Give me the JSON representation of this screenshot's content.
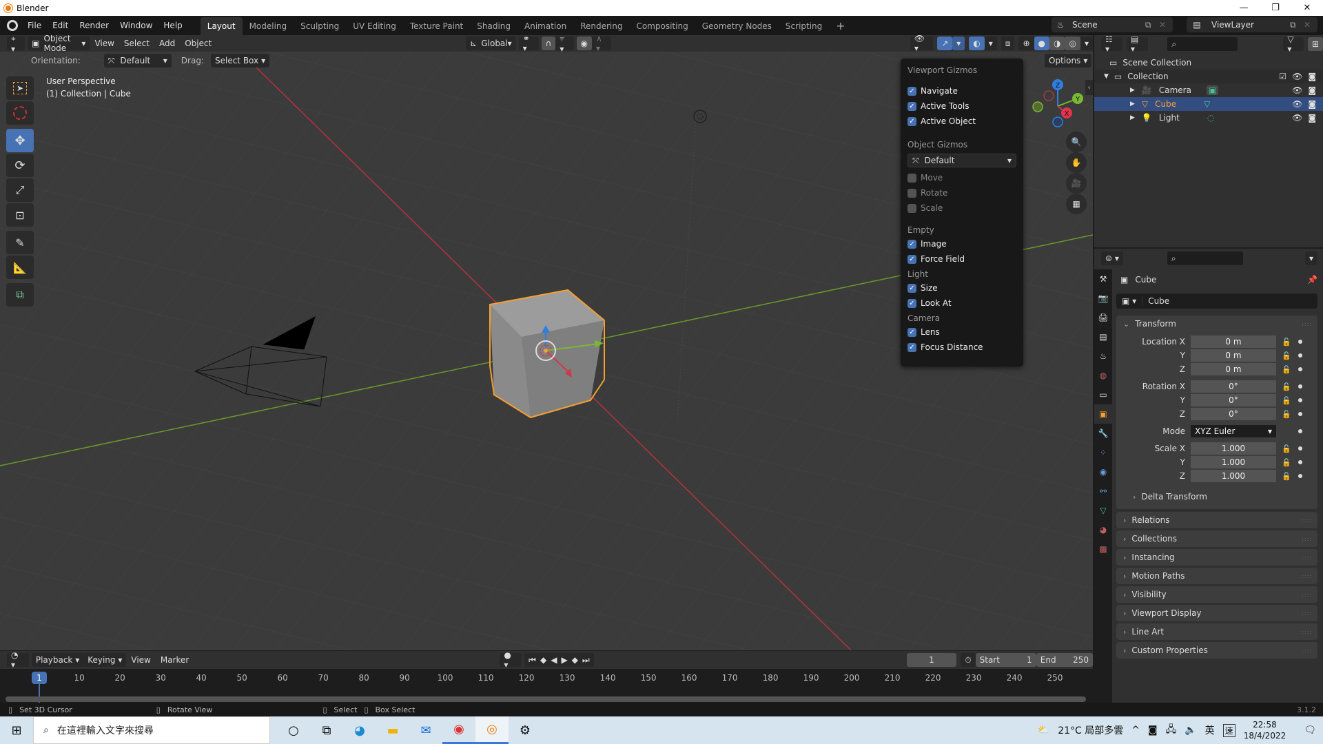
{
  "window": {
    "title": "Blender",
    "controls": [
      "minimize",
      "restore",
      "close"
    ]
  },
  "topbar": {
    "menus": [
      "File",
      "Edit",
      "Render",
      "Window",
      "Help"
    ],
    "workspaces": [
      "Layout",
      "Modeling",
      "Sculpting",
      "UV Editing",
      "Texture Paint",
      "Shading",
      "Animation",
      "Rendering",
      "Compositing",
      "Geometry Nodes",
      "Scripting"
    ],
    "active_workspace": "Layout",
    "add_workspace": "+",
    "scene": "Scene",
    "view_layer": "ViewLayer"
  },
  "viewport": {
    "header": {
      "mode": "Object Mode",
      "menus": [
        "View",
        "Select",
        "Add",
        "Object"
      ],
      "transform_orientation": "Global",
      "options_label": "Options"
    },
    "tool_settings": {
      "orientation_label": "Orientation:",
      "orientation_value": "Default",
      "drag_label": "Drag:",
      "drag_value": "Select Box"
    },
    "info": {
      "view_name": "User Perspective",
      "context": "(1) Collection | Cube"
    },
    "tools": [
      "select-box",
      "cursor",
      "move",
      "rotate",
      "scale",
      "transform",
      "annotate",
      "measure",
      "add-cube"
    ],
    "active_tool": "move",
    "nav_gizmo_axes": [
      "Z",
      "Y",
      "X"
    ]
  },
  "gizmo_popup": {
    "title": "Viewport Gizmos",
    "viewport_items": [
      {
        "label": "Navigate",
        "checked": true
      },
      {
        "label": "Active Tools",
        "checked": true
      },
      {
        "label": "Active Object",
        "checked": true
      }
    ],
    "object_gizmos_title": "Object Gizmos",
    "object_gizmos_orientation": "Default",
    "object_items": [
      {
        "label": "Move",
        "checked": false
      },
      {
        "label": "Rotate",
        "checked": false
      },
      {
        "label": "Scale",
        "checked": false
      }
    ],
    "empty_title": "Empty",
    "empty_items": [
      {
        "label": "Image",
        "checked": true
      },
      {
        "label": "Force Field",
        "checked": true
      }
    ],
    "light_title": "Light",
    "light_items": [
      {
        "label": "Size",
        "checked": true
      },
      {
        "label": "Look At",
        "checked": true
      }
    ],
    "camera_title": "Camera",
    "camera_items": [
      {
        "label": "Lens",
        "checked": true
      },
      {
        "label": "Focus Distance",
        "checked": true
      }
    ]
  },
  "outliner": {
    "root": "Scene Collection",
    "collection": "Collection",
    "items": [
      {
        "name": "Camera",
        "selected": false
      },
      {
        "name": "Cube",
        "selected": true
      },
      {
        "name": "Light",
        "selected": false
      }
    ]
  },
  "properties": {
    "object_name": "Cube",
    "datablock_name": "Cube",
    "transform_title": "Transform",
    "location": {
      "label": "Location X",
      "x": "0 m",
      "y": "0 m",
      "z": "0 m"
    },
    "rotation": {
      "label": "Rotation X",
      "x": "0°",
      "y": "0°",
      "z": "0°"
    },
    "mode_label": "Mode",
    "mode_value": "XYZ Euler",
    "scale": {
      "label": "Scale X",
      "x": "1.000",
      "y": "1.000",
      "z": "1.000"
    },
    "axis_labels": {
      "y": "Y",
      "z": "Z"
    },
    "delta_transform": "Delta Transform",
    "panels": [
      "Relations",
      "Collections",
      "Instancing",
      "Motion Paths",
      "Visibility",
      "Viewport Display",
      "Line Art",
      "Custom Properties"
    ]
  },
  "timeline": {
    "menus": [
      "Playback",
      "Keying",
      "View",
      "Marker"
    ],
    "current_frame": "1",
    "start_label": "Start",
    "start_value": "1",
    "end_label": "End",
    "end_value": "250",
    "frame_ticks": [
      "1",
      "10",
      "20",
      "30",
      "40",
      "50",
      "60",
      "70",
      "80",
      "90",
      "100",
      "110",
      "120",
      "130",
      "140",
      "150",
      "160",
      "170",
      "180",
      "190",
      "200",
      "210",
      "220",
      "230",
      "240",
      "250"
    ]
  },
  "statusbar": {
    "hints": [
      "Set 3D Cursor",
      "Rotate View",
      "Select",
      "Box Select"
    ],
    "version": "3.1.2"
  },
  "taskbar": {
    "search_placeholder": "在這裡輸入文字來搜尋",
    "weather": "21°C 局部多雲",
    "ime": "英",
    "ime2": "速",
    "time": "22:58",
    "date": "18/4/2022"
  },
  "colors": {
    "accent": "#4772b3",
    "selection_orange": "#f5a030",
    "x_axis": "#d0384b",
    "y_axis": "#7ab832",
    "z_axis": "#2f7fe0"
  }
}
